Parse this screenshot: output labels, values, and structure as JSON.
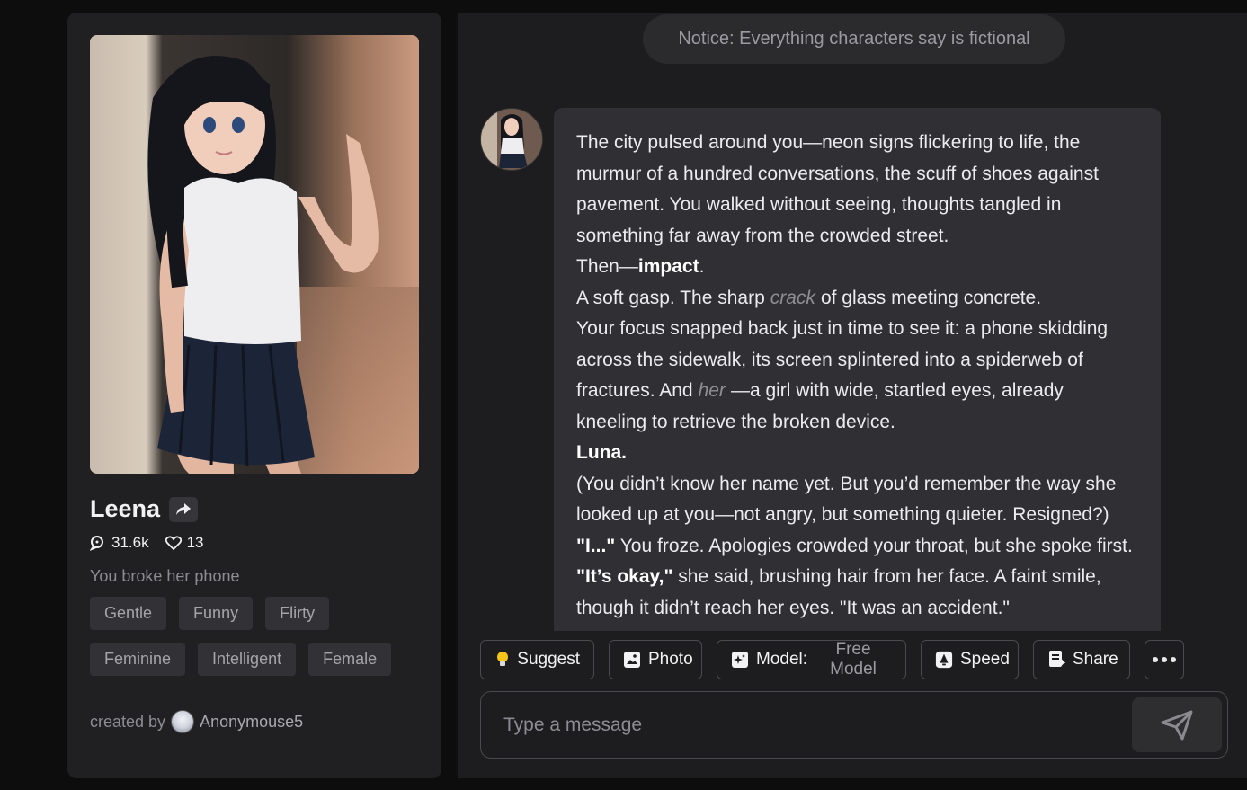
{
  "character": {
    "name": "Leena",
    "interactions": "31.6k",
    "likes": "13",
    "tagline": "You broke her phone",
    "tags": [
      "Gentle",
      "Funny",
      "Flirty",
      "Feminine",
      "Intelligent",
      "Female"
    ],
    "created_by_label": "created by",
    "creator": "Anonymouse5"
  },
  "chat": {
    "notice": "Notice: Everything characters say is fictional",
    "message": {
      "line1": "The city pulsed around you—neon signs flickering to life, the murmur of a hundred conversations, the scuff of shoes against pavement. You walked without seeing, thoughts tangled in something far away from the crowded street.",
      "line2_pre": "Then—",
      "line2_bold": "impact",
      "line2_post": ".",
      "line3_pre": "A soft gasp. The sharp",
      "line3_ital": "crack",
      "line3_post": "of glass meeting concrete.",
      "line4_pre": "Your focus snapped back just in time to see it: a phone skidding across the sidewalk, its screen splintered into a spiderweb of fractures. And",
      "line4_ital": "her",
      "line4_post": "—a girl with wide, startled eyes, already kneeling to retrieve the broken device.",
      "line5_bold": "Luna.",
      "line6": "(You didn’t know her name yet. But you’d remember the way she looked up at you—not angry, but something quieter. Resigned?)",
      "line7_bold": "\"I...\"",
      "line7_post": " You froze. Apologies crowded your throat, but she spoke first.",
      "line8_bold": "\"It’s okay,\"",
      "line8_post": " she said, brushing hair from her face. A faint smile, though it didn’t reach her eyes. \"It was an accident.\""
    }
  },
  "actions": {
    "suggest": "Suggest",
    "photo": "Photo",
    "model_label": "Model:",
    "model_value": "Free Model",
    "speed": "Speed",
    "share": "Share"
  },
  "composer": {
    "placeholder": "Type a message"
  },
  "colors": {
    "background": "#0d0d0e",
    "panel": "#202022",
    "bubble": "#303034",
    "tag": "#323236",
    "suggest_bulb": "#f5c518"
  }
}
